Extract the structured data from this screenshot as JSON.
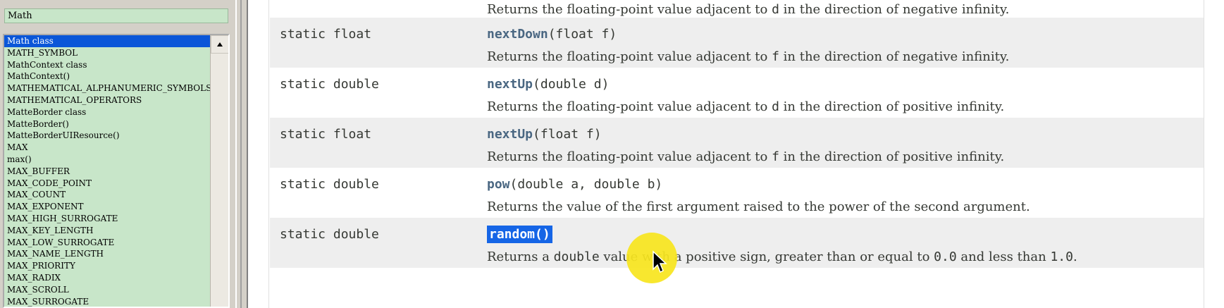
{
  "index": {
    "search_value": "Math",
    "items": [
      {
        "label": "Math class",
        "selected": true
      },
      {
        "label": "MATH_SYMBOL"
      },
      {
        "label": "MathContext class"
      },
      {
        "label": "MathContext()"
      },
      {
        "label": "MATHEMATICAL_ALPHANUMERIC_SYMBOLS"
      },
      {
        "label": "MATHEMATICAL_OPERATORS"
      },
      {
        "label": "MatteBorder class"
      },
      {
        "label": "MatteBorder()"
      },
      {
        "label": "MatteBorderUIResource()"
      },
      {
        "label": "MAX"
      },
      {
        "label": "max()"
      },
      {
        "label": "MAX_BUFFER"
      },
      {
        "label": "MAX_CODE_POINT"
      },
      {
        "label": "MAX_COUNT"
      },
      {
        "label": "MAX_EXPONENT"
      },
      {
        "label": "MAX_HIGH_SURROGATE"
      },
      {
        "label": "MAX_KEY_LENGTH"
      },
      {
        "label": "MAX_LOW_SURROGATE"
      },
      {
        "label": "MAX_NAME_LENGTH"
      },
      {
        "label": "MAX_PRIORITY"
      },
      {
        "label": "MAX_RADIX"
      },
      {
        "label": "MAX_SCROLL"
      },
      {
        "label": "MAX_SURROGATE"
      }
    ]
  },
  "methods": [
    {
      "modifier": "",
      "name": "",
      "params": "",
      "desc_before": "Returns the floating-point value adjacent to ",
      "desc_code": "d",
      "desc_after": " in the direction of negative infinity."
    },
    {
      "modifier": "static float",
      "name": "nextDown",
      "params": "(float f)",
      "desc_before": "Returns the floating-point value adjacent to ",
      "desc_code": "f",
      "desc_after": " in the direction of negative infinity."
    },
    {
      "modifier": "static double",
      "name": "nextUp",
      "params": "(double d)",
      "desc_before": "Returns the floating-point value adjacent to ",
      "desc_code": "d",
      "desc_after": " in the direction of positive infinity."
    },
    {
      "modifier": "static float",
      "name": "nextUp",
      "params": "(float f)",
      "desc_before": "Returns the floating-point value adjacent to ",
      "desc_code": "f",
      "desc_after": " in the direction of positive infinity."
    },
    {
      "modifier": "static double",
      "name": "pow",
      "params": "(double a, double b)",
      "desc_before": "Returns the value of the first argument raised to the power of the second argument.",
      "desc_code": "",
      "desc_after": ""
    },
    {
      "modifier": "static double",
      "name": "random()",
      "params": "",
      "highlighted": true,
      "desc_before": "Returns a ",
      "desc_code": "double",
      "desc_after": " value with a positive sign, greater than or equal to ",
      "desc_code2": "0.0",
      "desc_after2": " and less than ",
      "desc_code3": "1.0",
      "desc_after3": "."
    }
  ],
  "colors": {
    "list_bg": "#c8e6c9",
    "selection": "#0a56d8",
    "method_link": "#4a6782",
    "highlight": "#1565e6",
    "row_alt": "#eeeeee",
    "cursor_halo": "#f7e51f"
  },
  "icons": {
    "scroll_up": "triangle-up-icon",
    "cursor": "mouse-pointer-icon"
  }
}
